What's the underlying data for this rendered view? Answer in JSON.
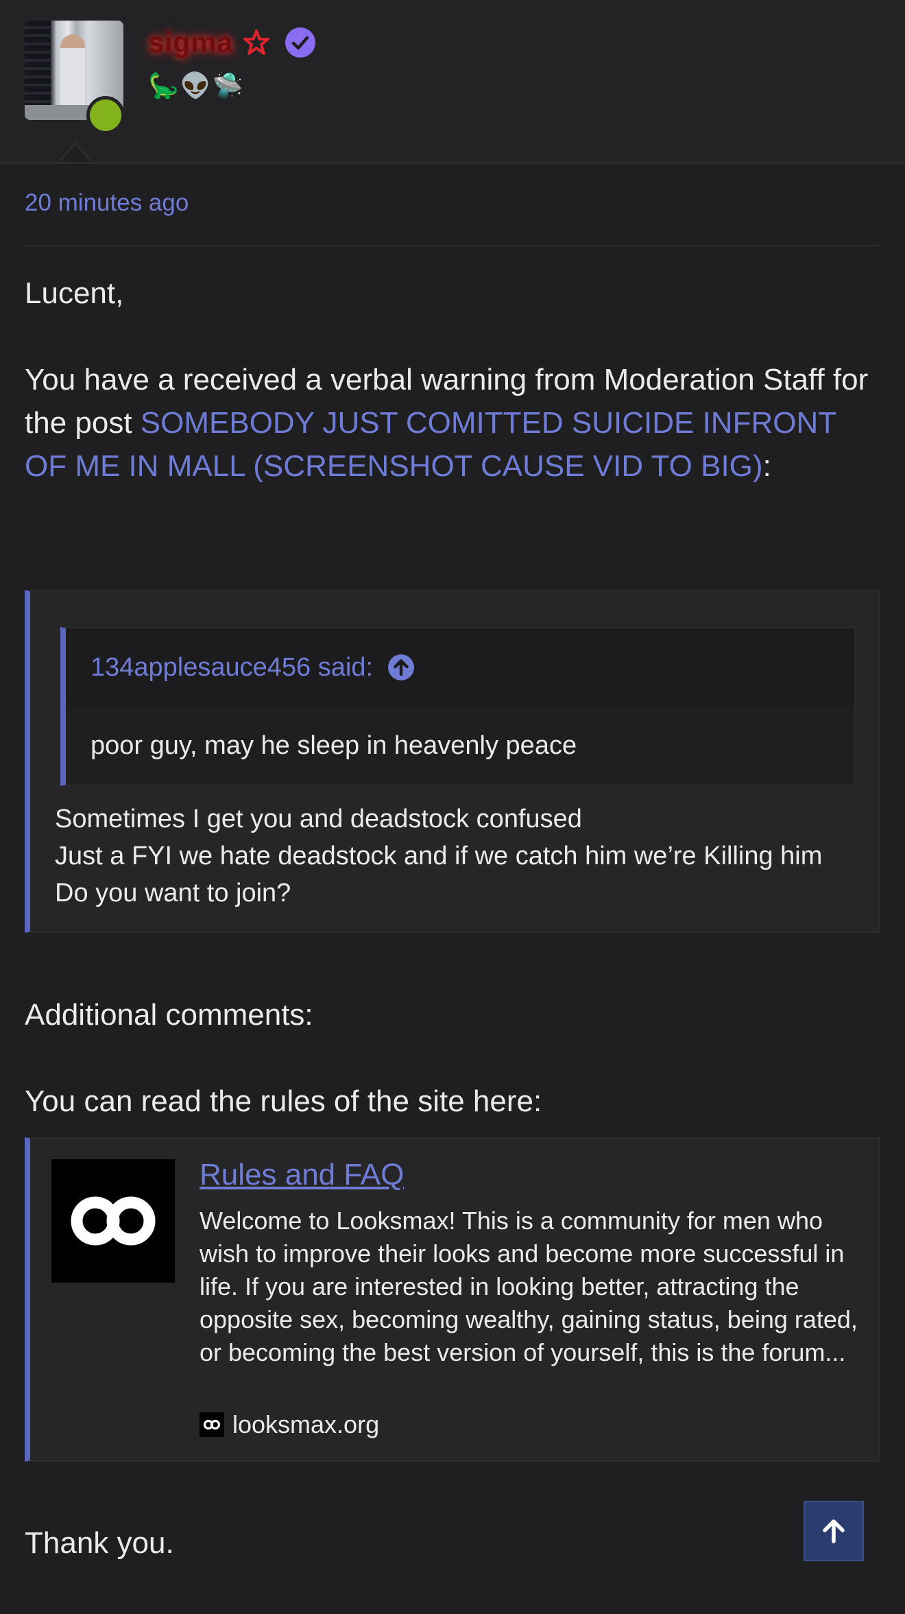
{
  "post": {
    "username": "sigma",
    "user_icons": [
      "star-icon",
      "verified-icon"
    ],
    "emojis": [
      "🦕",
      "👽",
      "🛸"
    ],
    "timestamp": "20 minutes ago"
  },
  "message": {
    "greeting": "Lucent,",
    "warning_text": "You have a received a verbal warning from Moderation Staff for the post ",
    "post_link": "SOMEBODY JUST COMITTED SUICIDE INFRONT OF ME IN MALL (SCREENSHOT CAUSE VID TO BIG)",
    "after_link": ":",
    "additional_comments": "Additional comments:",
    "rules_intro": "You can read the rules of the site here:",
    "sign_off": "Thank you."
  },
  "quote": {
    "inner_author": "134applesauce456 said:",
    "inner_text": "poor guy, may he sleep in heavenly peace",
    "lines": [
      "Sometimes I get you and deadstock confused",
      "Just a FYI we hate deadstock and if we catch him we’re Killing him",
      "Do you want to join?"
    ]
  },
  "embed": {
    "title": "Rules and FAQ",
    "description": "Welcome to Looksmax! This is a community for men who wish to improve their looks and become more successful in life. If you are interested in looking better, attracting the opposite sex, becoming wealthy, gaining status, being rated, or becoming the best version of yourself, this is the forum...",
    "source": "looksmax.org",
    "logo_icon": "infinity-logo-icon"
  },
  "colors": {
    "background": "#1f1f21",
    "link": "#6f7cd6",
    "quote_border": "#5b66c0",
    "online": "#82b31c",
    "username_glow": "#e02b2b",
    "verified": "#8a6cf0",
    "scroll_button": "#2b3d6e"
  }
}
